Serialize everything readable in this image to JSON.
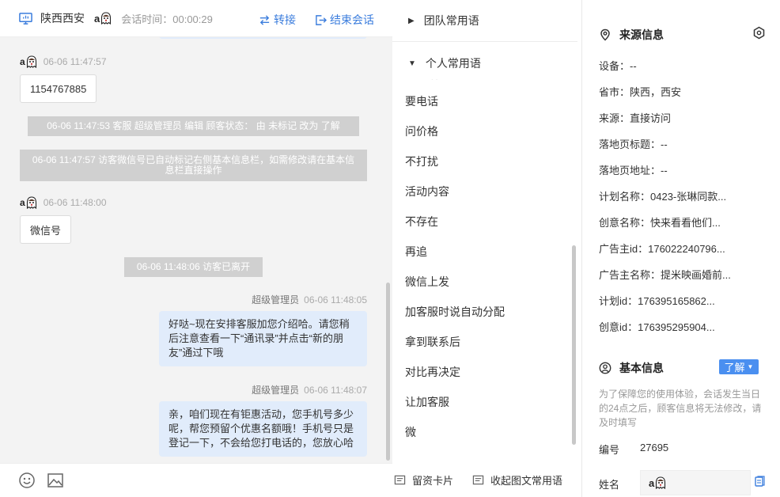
{
  "header": {
    "location": "陕西西安",
    "visitor_name": "a",
    "duration_label": "会话时间：",
    "duration": "00:00:29",
    "transfer_label": "转接",
    "end_label": "结束会话"
  },
  "messages": {
    "m1_sender": "a",
    "m1_time": "06-06 11:47:57",
    "m1_text": "1154767885",
    "sys1": "06-06 11:47:53 客服 超级管理员 编辑 顾客状态： 由 未标记 改为 了解",
    "sys2": "06-06 11:47:57 访客微信号已自动标记右侧基本信息栏，如需修改请在基本信息栏直接操作",
    "m2_sender": "a",
    "m2_time": "06-06 11:48:00",
    "m2_text": "微信号",
    "sys3": "06-06 11:48:06 访客已离开",
    "m3_sender": "超级管理员",
    "m3_time": "06-06 11:48:05",
    "m3_text": "好哒~现在安排客服加您介绍哈。请您稍后注意查看一下“通讯录”并点击“新的朋友”通过下哦",
    "m4_sender": "超级管理员",
    "m4_time": "06-06 11:48:07",
    "m4_text": "亲，咱们现在有钜惠活动，您手机号多少呢，帮您预留个优惠名额哦！手机号只是登记一下，不会给您打电话的，您放心哈"
  },
  "quick_phrases": {
    "team_label": "团队常用语",
    "personal_label": "个人常用语",
    "items": [
      "要电话",
      "问价格",
      "不打扰",
      "活动内容",
      "不存在",
      "再追",
      "微信上发",
      "加客服时说自动分配",
      "拿到联系后",
      "对比再决定",
      "让加客服",
      "微"
    ],
    "card_label": "留资卡片",
    "rich_label": "收起图文常用语"
  },
  "source_info": {
    "title": "来源信息",
    "device": "设备：--",
    "province": "省市：陕西，西安",
    "source": "来源：直接访问",
    "landing_title": "落地页标题：--",
    "landing_url": "落地页地址：--",
    "plan_name": "计划名称：0423-张琳同款...",
    "creative_name": "创意名称：快来看看他们...",
    "advertiser_id": "广告主id：176022240796...",
    "advertiser_name": "广告主名称：提米映画婚前...",
    "plan_id": "计划id：176395165862...",
    "creative_id": "创意id：176395295904..."
  },
  "basic_info": {
    "title": "基本信息",
    "status": "了解",
    "note": "为了保障您的使用体验，会话发生当日的24点之后，顾客信息将无法修改，请及时填写",
    "id_label": "编号",
    "id_value": "27695",
    "name_label": "姓名",
    "name_value": "a"
  },
  "colors": {
    "accent": "#3b7ddd",
    "agent_bubble": "#e1ecfb",
    "system_pill": "#d0d0d0",
    "dropdown": "#4a8ff0"
  }
}
